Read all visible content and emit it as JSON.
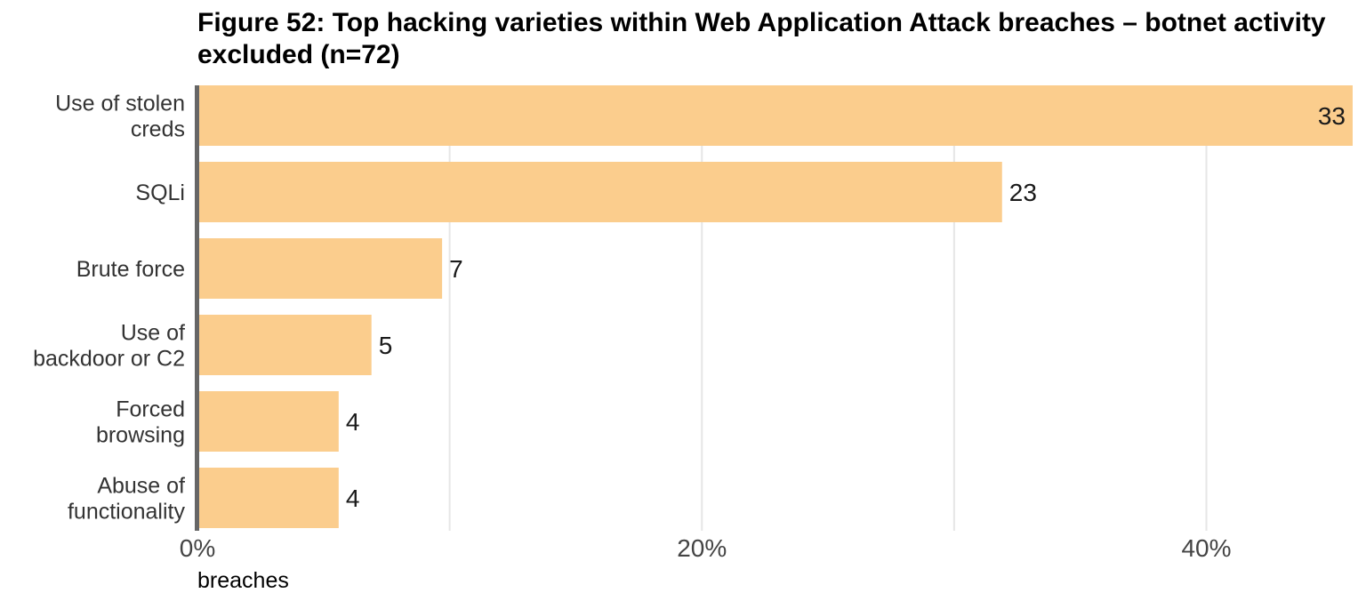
{
  "chart_data": {
    "type": "bar",
    "orientation": "horizontal",
    "title": "Figure 52: Top hacking varieties within Web Application Attack breaches – botnet activity excluded (n=72)",
    "categories": [
      [
        "Use of stolen",
        "creds"
      ],
      [
        "SQLi"
      ],
      [
        "Brute force"
      ],
      [
        "Use of",
        "backdoor or C2"
      ],
      [
        "Forced",
        "browsing"
      ],
      [
        "Abuse of",
        "functionality"
      ]
    ],
    "values": [
      33,
      23,
      7,
      5,
      4,
      4
    ],
    "percent_values": [
      45.8,
      31.9,
      9.7,
      6.9,
      5.6,
      5.6
    ],
    "value_labels": [
      "33",
      "23",
      "7",
      "5",
      "4",
      "4"
    ],
    "xlabel": "breaches",
    "xlim": [
      0,
      45.8
    ],
    "x_ticks": [
      0,
      20,
      40
    ],
    "x_tick_labels": [
      "0%",
      "20%",
      "40%"
    ],
    "minor_gridlines": [
      10,
      20,
      30,
      40
    ],
    "bar_color": "#fbcd8d",
    "axis_color": "#666666",
    "grid_color": "#e6e6e6",
    "legend": "none"
  }
}
